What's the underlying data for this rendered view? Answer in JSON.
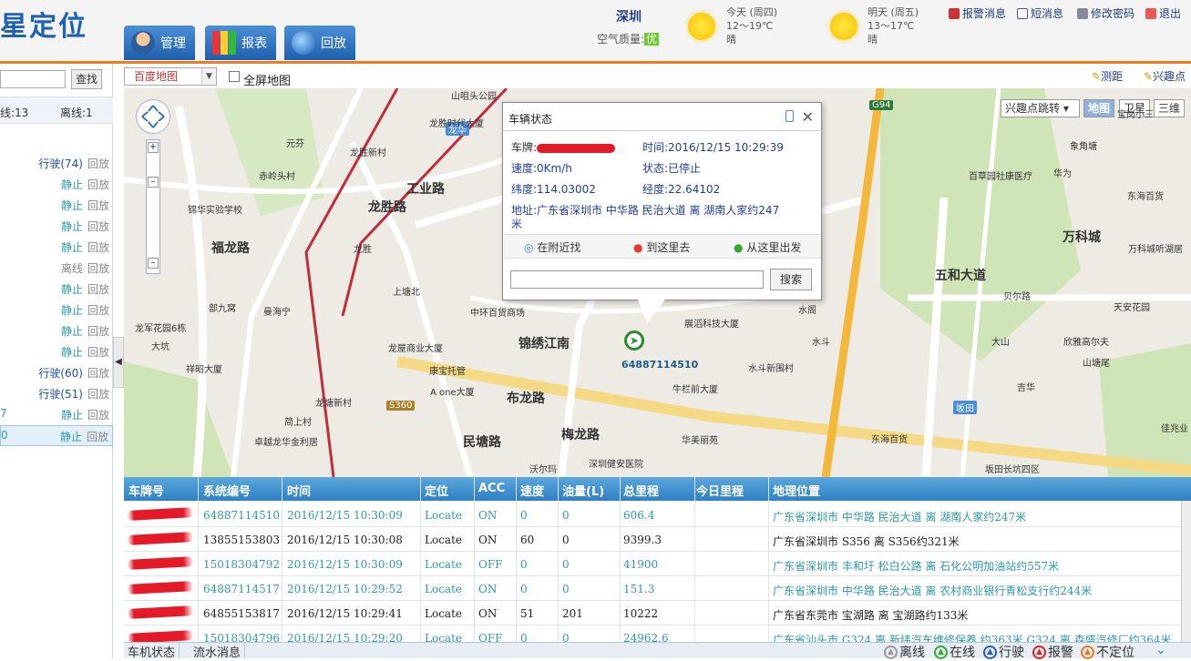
{
  "header": {
    "brand": "星定位",
    "nav": [
      "管理",
      "报表",
      "回放"
    ],
    "city": "深圳",
    "aq_label": "空气质量:",
    "aq_value": "优",
    "today": {
      "title": "今天 (周四)",
      "temp": "12～19℃",
      "desc": "晴"
    },
    "tomorrow": {
      "title": "明天 (周五)",
      "temp": "13～17℃",
      "desc": "晴"
    },
    "menu": [
      "报警消息",
      "短消息",
      "修改密码",
      "退出"
    ]
  },
  "left": {
    "find": "查找",
    "online": "线:13",
    "offline": "离线:1",
    "rows": [
      {
        "status": "行驶(74)",
        "replay": "回放",
        "kind": "drive",
        "prefix": ""
      },
      {
        "status": "静止",
        "replay": "回放",
        "kind": "stop",
        "prefix": ""
      },
      {
        "status": "静止",
        "replay": "回放",
        "kind": "stop",
        "prefix": ""
      },
      {
        "status": "静止",
        "replay": "回放",
        "kind": "stop",
        "prefix": ""
      },
      {
        "status": "静止",
        "replay": "回放",
        "kind": "stop",
        "prefix": ""
      },
      {
        "status": "离线",
        "replay": "回放",
        "kind": "off",
        "prefix": ""
      },
      {
        "status": "静止",
        "replay": "回放",
        "kind": "stop",
        "prefix": ""
      },
      {
        "status": "静止",
        "replay": "回放",
        "kind": "stop",
        "prefix": ""
      },
      {
        "status": "静止",
        "replay": "回放",
        "kind": "stop",
        "prefix": ""
      },
      {
        "status": "静止",
        "replay": "回放",
        "kind": "stop",
        "prefix": ""
      },
      {
        "status": "行驶(60)",
        "replay": "回放",
        "kind": "drive",
        "prefix": ""
      },
      {
        "status": "行驶(51)",
        "replay": "回放",
        "kind": "drive",
        "prefix": ""
      },
      {
        "status": "静止",
        "replay": "回放",
        "kind": "stop",
        "prefix": "7"
      },
      {
        "status": "静止",
        "replay": "回放",
        "kind": "stop",
        "prefix": "0"
      }
    ]
  },
  "toolbar": {
    "map_select": "百度地图",
    "fullscreen": "全屏地图",
    "measure": "测距",
    "poi": "兴趣点"
  },
  "map": {
    "poi_jump": "兴趣点跳转",
    "types": [
      "地图",
      "卫星",
      "三维"
    ],
    "labels": [
      "元芬",
      "赤岭头村",
      "锦华实验学校",
      "龙胜新村",
      "工业路",
      "龙胜路",
      "龙胜",
      "上塘北",
      "福龙路",
      "部九窝",
      "曼海宁",
      "龙军花园6栋",
      "大坑",
      "祥昭大厦",
      "中环百货商场",
      "锦绣江南",
      "龙屋商业大厦",
      "康宝托管",
      "A one大厦",
      "龙塘新村",
      "布龙路",
      "民塘路",
      "梅龙路",
      "简上村",
      "卓越龙华金利居",
      "沃尔玛",
      "深圳健安医院",
      "华美丽苑",
      "牛栏前大厦",
      "水斗新围村",
      "展滔科技大厦",
      "吉华",
      "坂田",
      "贝尔路",
      "万科城",
      "华为",
      "五和大道",
      "东海百货",
      "S360",
      "G94",
      "龙华",
      "龙胜时代大厦",
      "山咀头公园",
      "百草园社康医疗",
      "象角塘",
      "东海百货",
      "天安花园",
      "大山",
      "欣雅高尔夫",
      "山塘尾",
      "坂田长坑四区",
      "万科城听湖居",
      "佳兆业",
      "宝岗小三",
      "水斗",
      "水阁"
    ],
    "marker_id": "64887114510"
  },
  "popup": {
    "title": "车辆状态",
    "plate_label": "车牌:",
    "time": "时间:2016/12/15 10:29:39",
    "speed": "速度:0Km/h",
    "state": "状态:已停止",
    "lat": "纬度:114.03002",
    "lng": "经度:22.64102",
    "addr": "地址:广东省深圳市  中华路  民治大道  离  湖南人家约247",
    "addr2": "米",
    "nearby": "在附近找",
    "goto": "到这里去",
    "from": "从这里出发",
    "search": "搜索"
  },
  "grid": {
    "headers": [
      "车牌号",
      "系统编号",
      "时间",
      "定位",
      "ACC",
      "速度",
      "油量(L)",
      "总里程",
      "今日里程",
      "地理位置"
    ],
    "rows": [
      {
        "sys": "64887114510",
        "time": "2016/12/15 10:30:09",
        "loc": "Locate",
        "acc": "ON",
        "speed": "0",
        "oil": "0",
        "total": "606.4",
        "today": "",
        "addr": "广东省深圳市  中华路  民治大道  离  湖南人家约247米",
        "color": "tc"
      },
      {
        "sys": "13855153803",
        "time": "2016/12/15 10:30:08",
        "loc": "Locate",
        "acc": "ON",
        "speed": "60",
        "oil": "0",
        "total": "9399.3",
        "today": "",
        "addr": "广东省深圳市    S356  离  S356约321米",
        "color": "bk"
      },
      {
        "sys": "15018304792",
        "time": "2016/12/15 10:30:09",
        "loc": "Locate",
        "acc": "OFF",
        "speed": "0",
        "oil": "0",
        "total": "41900",
        "today": "",
        "addr": "广东省深圳市  丰和圩  松白公路  离  石化公明加油站约557米",
        "color": "tc"
      },
      {
        "sys": "64887114517",
        "time": "2016/12/15 10:29:52",
        "loc": "Locate",
        "acc": "ON",
        "speed": "0",
        "oil": "0",
        "total": "151.3",
        "today": "",
        "addr": "广东省深圳市  中华路  民治大道  离  农村商业银行青松支行约244米",
        "color": "tc"
      },
      {
        "sys": "64855153817",
        "time": "2016/12/15 10:29:41",
        "loc": "Locate",
        "acc": "ON",
        "speed": "51",
        "oil": "201",
        "total": "10222",
        "today": "",
        "addr": "广东省东莞市    宝湖路      离  宝湖路约133米",
        "color": "bk"
      },
      {
        "sys": "15018304796",
        "time": "2016/12/15 10:29:20",
        "loc": "Locate",
        "acc": "OFF",
        "speed": "0",
        "oil": "0",
        "total": "24962.6",
        "today": "",
        "addr": "广东省汕头市  G324 离  新纬汽车维修保养  约363米    G324 离  森盛汽修厂约364米",
        "color": "tc"
      }
    ]
  },
  "bottom": {
    "tabs": [
      "车机状态",
      "流水消息"
    ],
    "legend": [
      "离线",
      "在线",
      "行驶",
      "报警",
      "不定位"
    ]
  },
  "colors": {
    "accent": "#e8801f",
    "brand": "#1f63b0",
    "teal": "#2d9aa6",
    "header_grid": "#3a8bd0"
  }
}
